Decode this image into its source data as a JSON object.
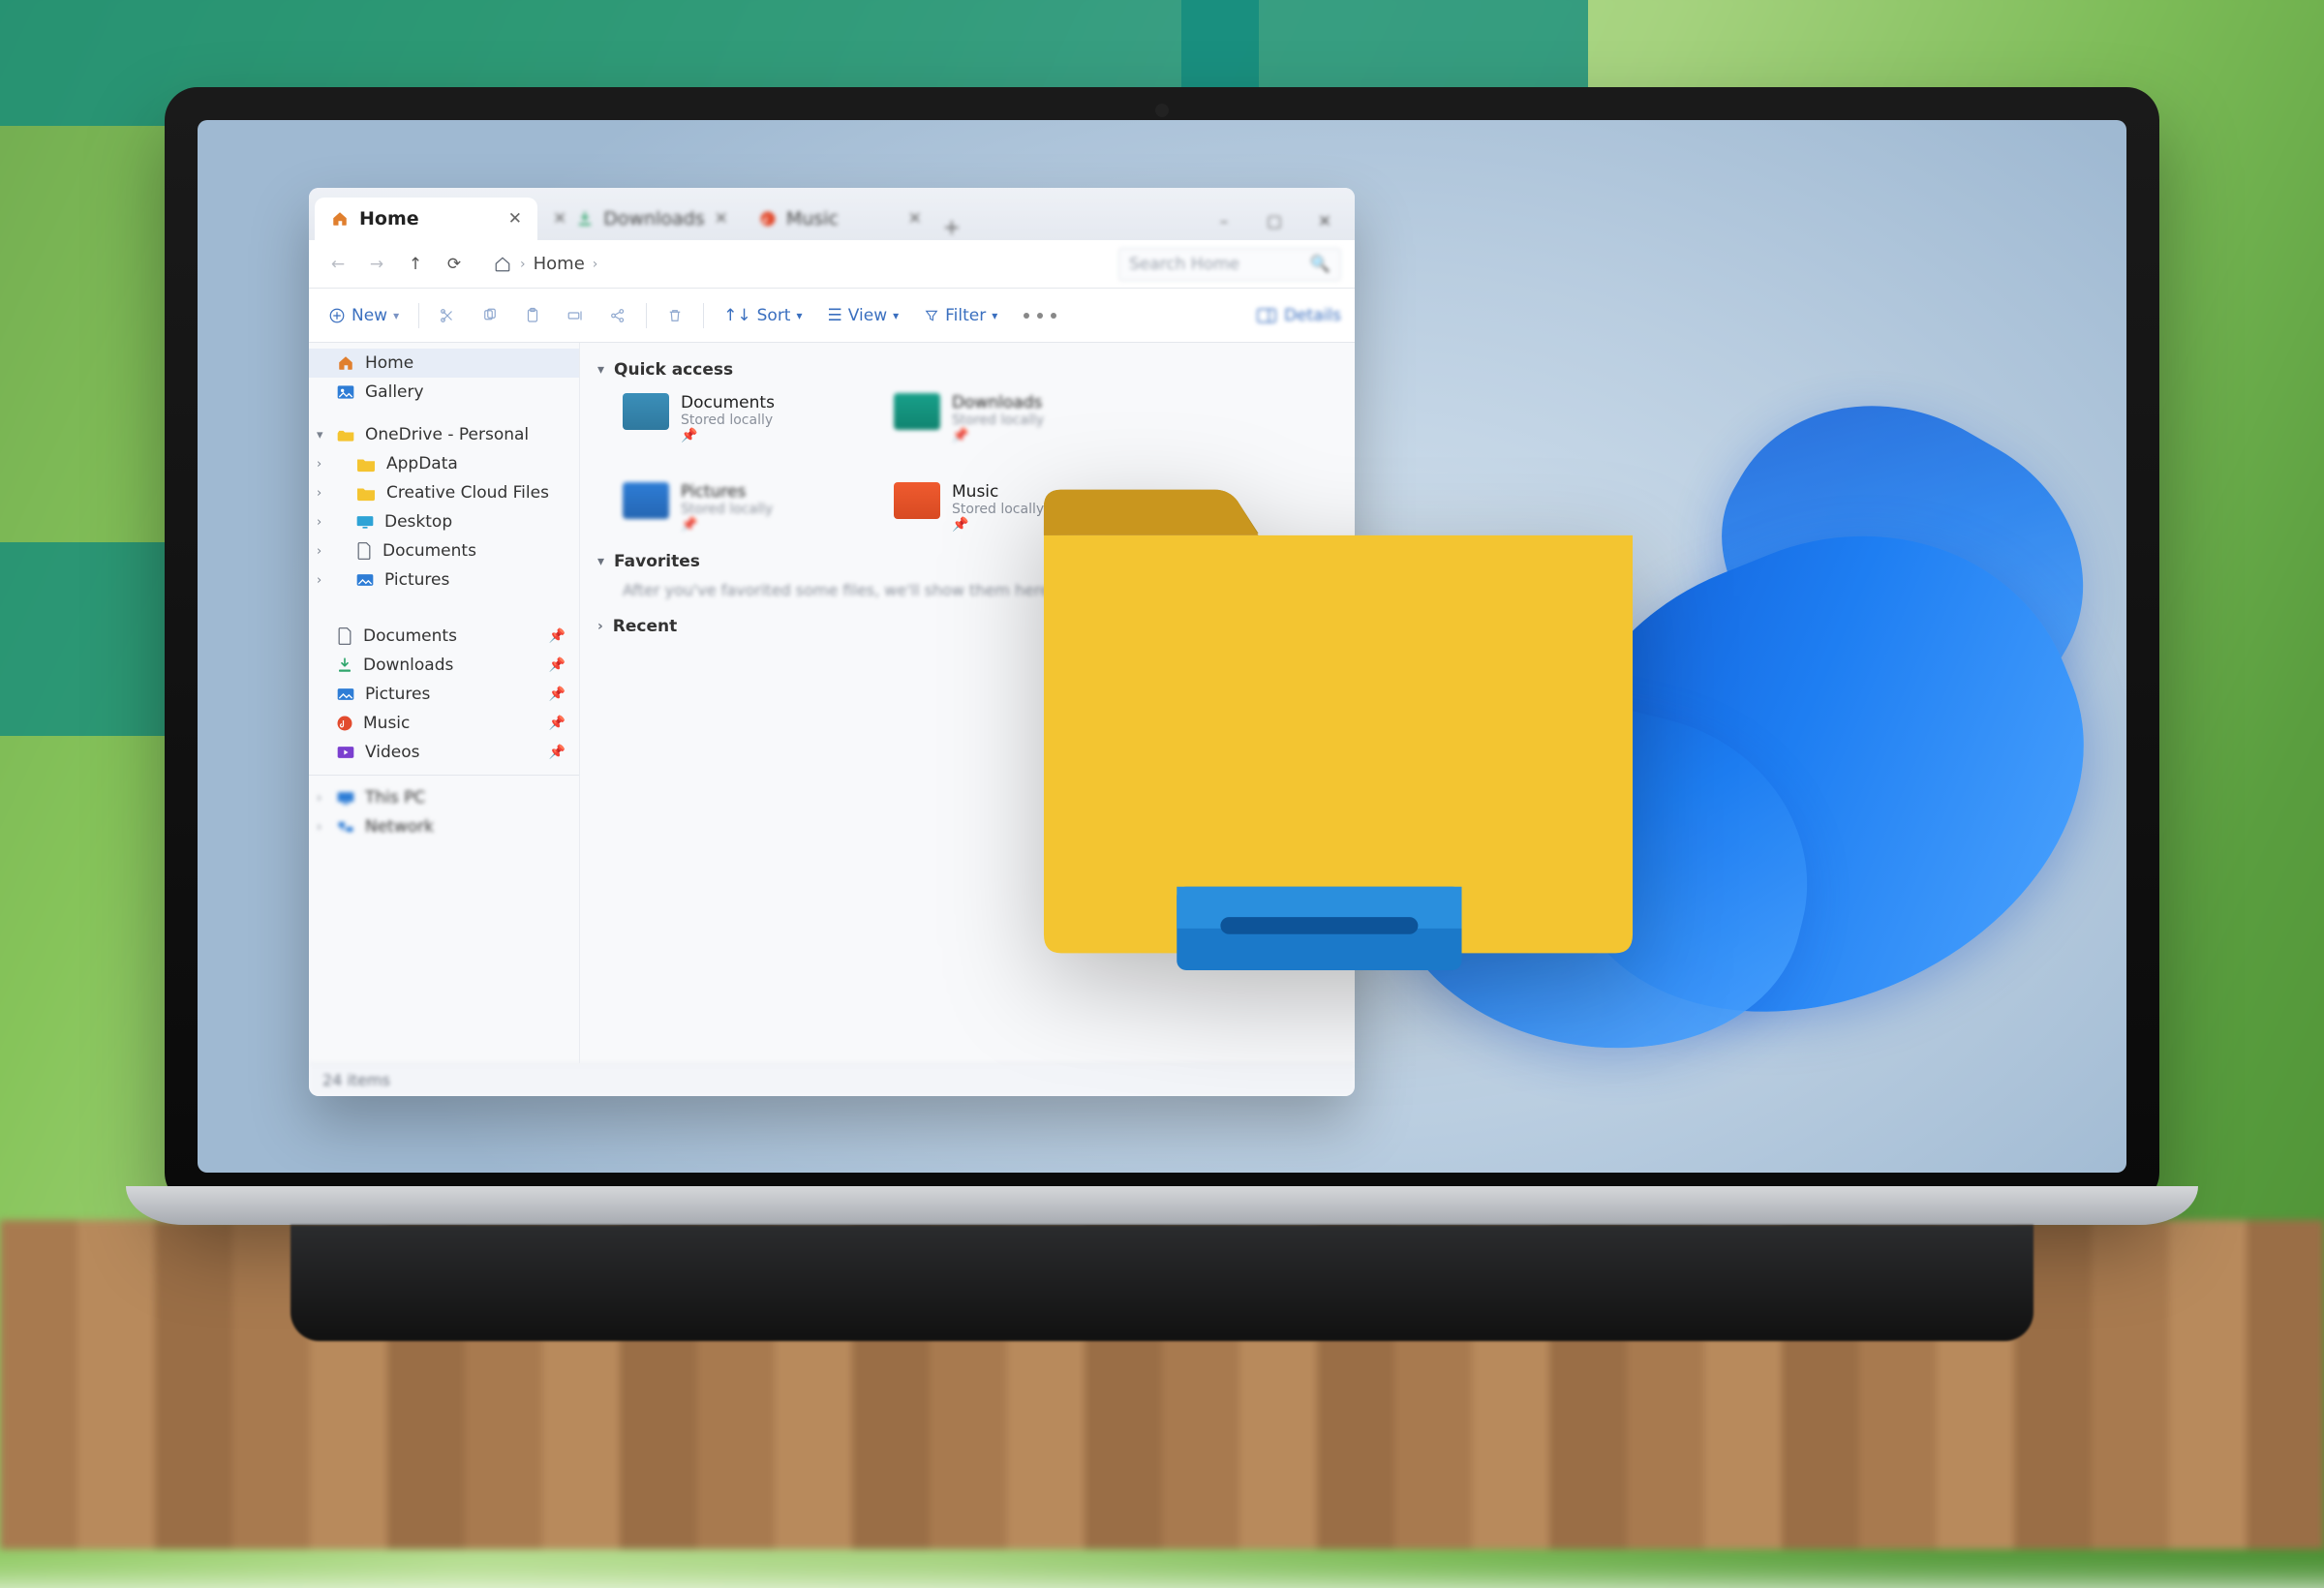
{
  "window": {
    "tabs": [
      {
        "label": "Home",
        "icon": "home",
        "active": true
      },
      {
        "label": "Downloads",
        "icon": "downloads",
        "active": false
      },
      {
        "label": "Music",
        "icon": "music",
        "active": false
      }
    ],
    "controls": {
      "minimize": "–",
      "maximize": "▢",
      "close": "✕"
    }
  },
  "address": {
    "crumbs": [
      "Home"
    ],
    "search_placeholder": "Search Home"
  },
  "toolbar": {
    "new_label": "New",
    "sort_label": "Sort",
    "view_label": "View",
    "filter_label": "Filter",
    "details_label": "Details"
  },
  "sidebar": {
    "items": [
      {
        "label": "Home",
        "icon": "home",
        "active": true
      },
      {
        "label": "Gallery",
        "icon": "gallery"
      },
      {
        "label": "OneDrive - Personal",
        "icon": "onedrive",
        "chev": "▾"
      },
      {
        "label": "AppData",
        "icon": "folder",
        "indent": true,
        "chev": "›"
      },
      {
        "label": "Creative Cloud Files",
        "icon": "folder",
        "indent": true,
        "chev": "›"
      },
      {
        "label": "Desktop",
        "icon": "desktop",
        "indent": true,
        "chev": "›"
      },
      {
        "label": "Documents",
        "icon": "documents",
        "indent": true,
        "chev": "›"
      },
      {
        "label": "Pictures",
        "icon": "pictures",
        "indent": true,
        "chev": "›"
      }
    ],
    "pinned": [
      {
        "label": "Documents",
        "icon": "documents"
      },
      {
        "label": "Downloads",
        "icon": "downloads"
      },
      {
        "label": "Pictures",
        "icon": "pictures"
      },
      {
        "label": "Music",
        "icon": "music"
      },
      {
        "label": "Videos",
        "icon": "videos"
      }
    ],
    "system": [
      {
        "label": "This PC",
        "icon": "pc",
        "chev": "›"
      },
      {
        "label": "Network",
        "icon": "network",
        "chev": "›"
      }
    ]
  },
  "main": {
    "quick_access": {
      "title": "Quick access",
      "items": [
        {
          "title": "Documents",
          "subtitle": "Stored locally",
          "color": "#3b8fb9"
        },
        {
          "title": "Downloads",
          "subtitle": "Stored locally",
          "color": "#18a08a"
        },
        {
          "title": "Pictures",
          "subtitle": "Stored locally",
          "color": "#2e7dd6"
        },
        {
          "title": "Music",
          "subtitle": "Stored locally",
          "color": "#ef5b2f"
        }
      ]
    },
    "favorites": {
      "title": "Favorites",
      "note": "After you've favorited some files, we'll show them here."
    },
    "recent": {
      "title": "Recent"
    }
  },
  "status": {
    "items_text": "24 items"
  }
}
